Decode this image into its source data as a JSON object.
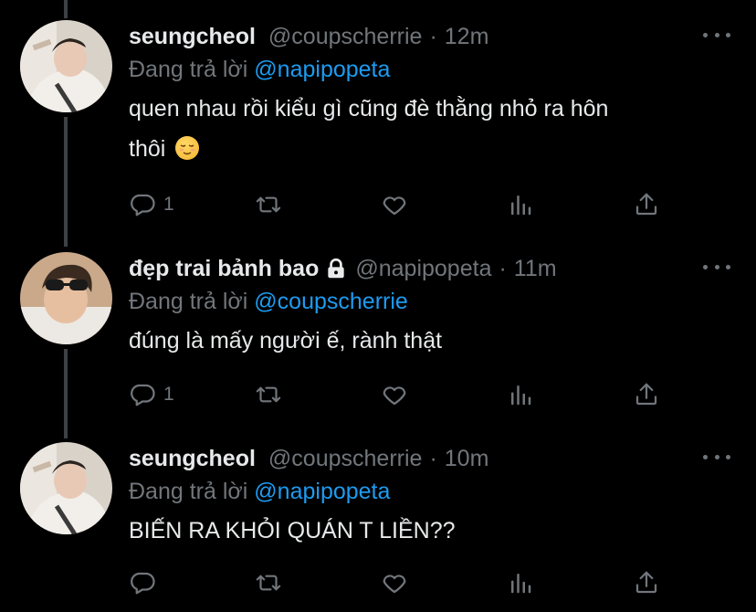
{
  "tweets": [
    {
      "name": "seungcheol",
      "handle": "@coupscherrie",
      "separator": "·",
      "time": "12m",
      "reply_prefix": "Đang trả lời",
      "reply_to": "@napipopeta",
      "text_line1": "quen nhau rồi kiểu gì cũng đè thằng nhỏ ra hôn",
      "text_line2": "thôi",
      "emoji": "relieved-face",
      "reply_count": "1",
      "locked": false
    },
    {
      "name": "đẹp trai bảnh bao",
      "handle": "@napipopeta",
      "separator": "·",
      "time": "11m",
      "reply_prefix": "Đang trả lời",
      "reply_to": "@coupscherrie",
      "text_line1": "đúng là mấy người ế, rành thật",
      "reply_count": "1",
      "locked": true
    },
    {
      "name": "seungcheol",
      "handle": "@coupscherrie",
      "separator": "·",
      "time": "10m",
      "reply_prefix": "Đang trả lời",
      "reply_to": "@napipopeta",
      "text_line1": "BIẾN RA KHỎI QUÁN T LIỀN??",
      "reply_count": "",
      "locked": false
    }
  ],
  "colors": {
    "background": "#000000",
    "text": "#e7e9ea",
    "muted": "#71767b",
    "link": "#1d9bf0",
    "thread_line": "#3e4144"
  }
}
